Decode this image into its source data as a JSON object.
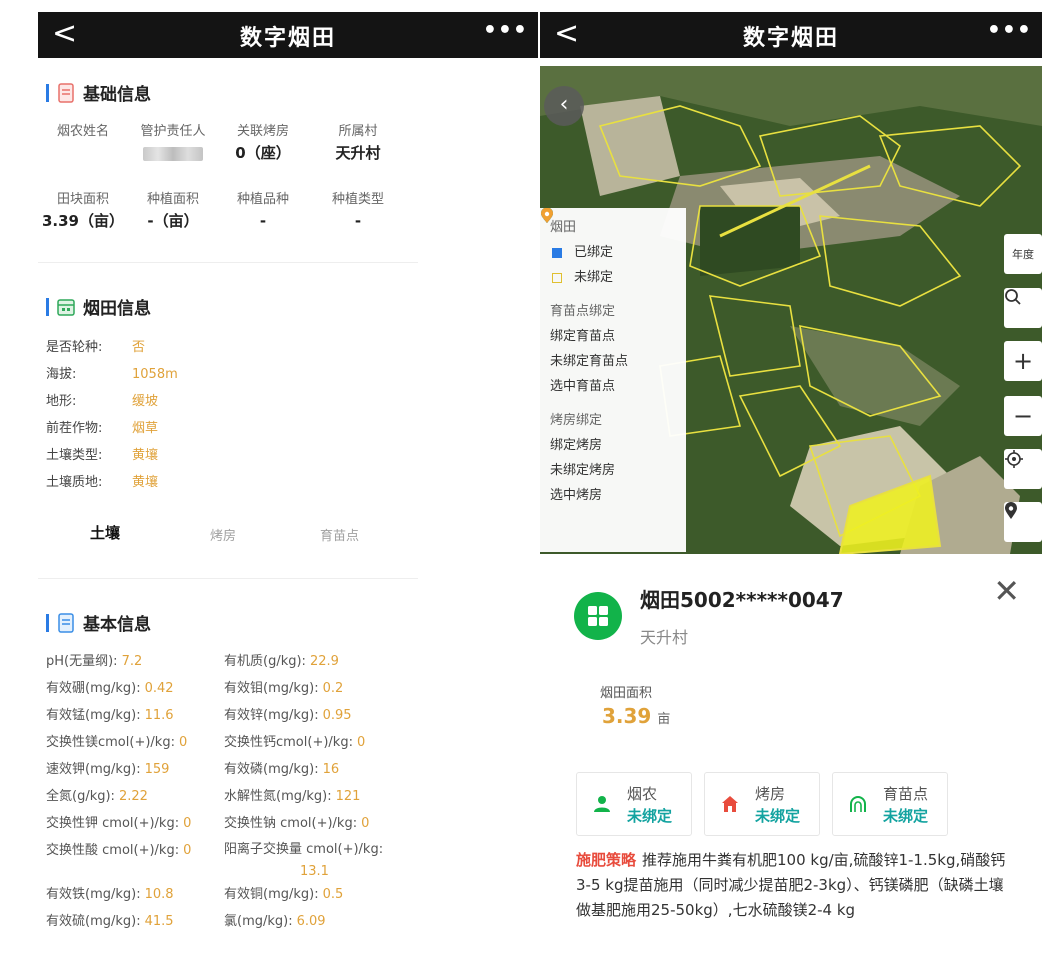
{
  "left": {
    "title": "数字烟田",
    "back": "<",
    "more": "•••",
    "basic_info": {
      "heading": "基础信息",
      "row1": [
        {
          "label": "烟农姓名",
          "value": ""
        },
        {
          "label": "管护责任人",
          "value": ""
        },
        {
          "label": "关联烤房",
          "value": "0（座）"
        },
        {
          "label": "所属村",
          "value": "天升村"
        }
      ],
      "row2": [
        {
          "label": "田块面积",
          "value": "3.39（亩）"
        },
        {
          "label": "种植面积",
          "value": "-（亩）"
        },
        {
          "label": "种植品种",
          "value": "-"
        },
        {
          "label": "种植类型",
          "value": "-"
        }
      ]
    },
    "field_info": {
      "heading": "烟田信息",
      "items": [
        {
          "key": "是否轮种:",
          "value": "否"
        },
        {
          "key": "海拔:",
          "value": "1058m"
        },
        {
          "key": "地形:",
          "value": "缓坡"
        },
        {
          "key": "前茬作物:",
          "value": "烟草"
        },
        {
          "key": "土壤类型:",
          "value": "黄壤"
        },
        {
          "key": "土壤质地:",
          "value": "黄壤"
        }
      ]
    },
    "tabs": [
      "土壤",
      "烤房",
      "育苗点"
    ],
    "soil_info": {
      "heading": "基本信息",
      "rows": [
        [
          {
            "label": "pH(无量纲):",
            "value": "7.2"
          },
          {
            "label": "有机质(g/kg):",
            "value": "22.9"
          }
        ],
        [
          {
            "label": "有效硼(mg/kg):",
            "value": "0.42"
          },
          {
            "label": "有效钼(mg/kg):",
            "value": "0.2"
          }
        ],
        [
          {
            "label": "有效锰(mg/kg):",
            "value": "11.6"
          },
          {
            "label": "有效锌(mg/kg):",
            "value": "0.95"
          }
        ],
        [
          {
            "label": "交换性镁cmol(+)/kg:",
            "value": "0"
          },
          {
            "label": "交换性钙cmol(+)/kg:",
            "value": "0"
          }
        ],
        [
          {
            "label": "速效钾(mg/kg):",
            "value": "159"
          },
          {
            "label": "有效磷(mg/kg):",
            "value": "16"
          }
        ],
        [
          {
            "label": "全氮(g/kg):",
            "value": "2.22"
          },
          {
            "label": "水解性氮(mg/kg):",
            "value": "121"
          }
        ],
        [
          {
            "label": "交换性钾 cmol(+)/kg:",
            "value": "0"
          },
          {
            "label": "交换性钠 cmol(+)/kg:",
            "value": "0"
          }
        ],
        [
          {
            "label": "交换性酸 cmol(+)/kg:",
            "value": "0"
          },
          {
            "label": "阳离子交换量 cmol(+)/kg:",
            "value": "13.1"
          }
        ],
        [
          {
            "label": "有效铁(mg/kg):",
            "value": "10.8"
          },
          {
            "label": "有效铜(mg/kg):",
            "value": "0.5"
          }
        ],
        [
          {
            "label": "有效硫(mg/kg):",
            "value": "41.5"
          },
          {
            "label": "氯(mg/kg):",
            "value": "6.09"
          }
        ]
      ]
    }
  },
  "right": {
    "title": "数字烟田",
    "back": "<",
    "more": "•••",
    "legend": {
      "group1": "烟田",
      "bound": "已绑定",
      "unbound": "未绑定",
      "group2": "育苗点绑定",
      "seed_bound": "绑定育苗点",
      "seed_unbound": "未绑定育苗点",
      "seed_selected": "选中育苗点",
      "group3": "烤房绑定",
      "house_bound": "绑定烤房",
      "house_unbound": "未绑定烤房",
      "house_selected": "选中烤房"
    },
    "tools": {
      "year": "年度",
      "search": "⌕",
      "zoom_in": "+",
      "zoom_out": "−",
      "locate": "⊙",
      "pin": "⬤"
    },
    "card": {
      "title": "烟田5002*****0047",
      "village": "天升村",
      "close": "✕",
      "area_label": "烟田面积",
      "area_value": "3.39",
      "area_unit": "亩"
    },
    "bindings": [
      {
        "label": "烟农",
        "status": "未绑定"
      },
      {
        "label": "烤房",
        "status": "未绑定"
      },
      {
        "label": "育苗点",
        "status": "未绑定"
      }
    ],
    "strategy": {
      "label": "施肥策略",
      "text": "推荐施用牛粪有机肥100 kg/亩,硫酸锌1-1.5kg,硝酸钙3-5 kg提苗施用（同时减少提苗肥2-3kg）、钙镁磷肥（缺磷土壤做基肥施用25-50kg）,七水硫酸镁2-4 kg"
    },
    "colors": {
      "green": "#12b34a",
      "teal": "#13a3a0",
      "gold": "#e0a23a",
      "red": "#e84c3d",
      "blue": "#2a7be4"
    }
  }
}
